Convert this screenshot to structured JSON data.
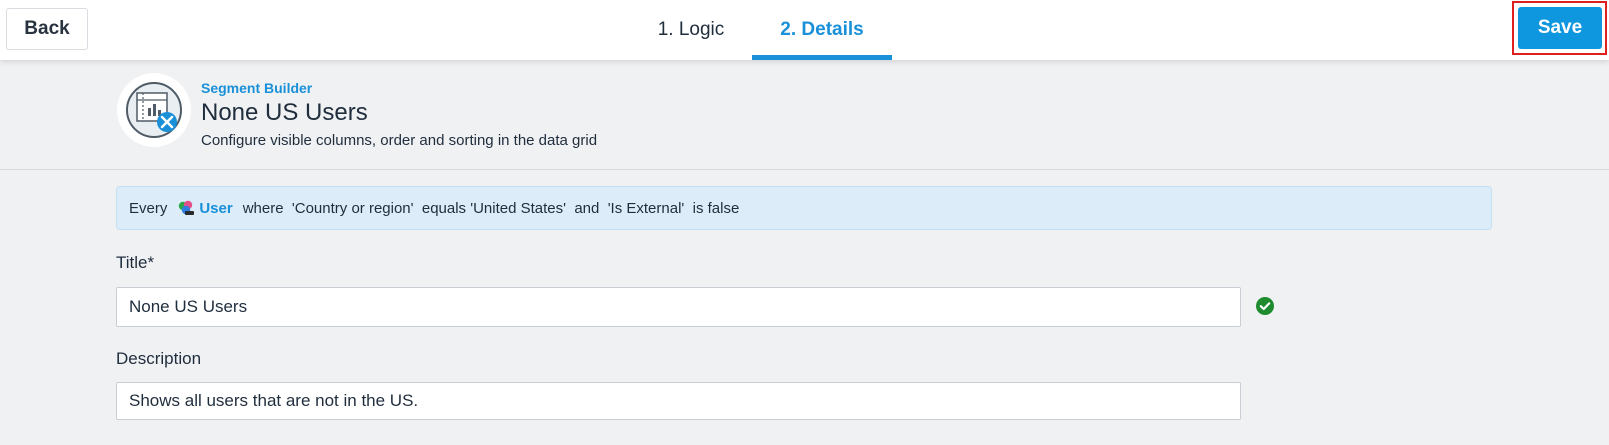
{
  "toolbar": {
    "back_label": "Back",
    "save_label": "Save",
    "tabs": [
      {
        "label": "1. Logic",
        "active": false
      },
      {
        "label": "2. Details",
        "active": true
      }
    ]
  },
  "header": {
    "breadcrumb": "Segment Builder",
    "title": "None US Users",
    "subtitle": "Configure visible columns, order and sorting in the data grid",
    "logo_icon": "segment-builder-icon"
  },
  "rule": {
    "prefix": "Every",
    "entity": "User",
    "entity_icon": "user-entity-icon",
    "condition": "where  'Country or region'  equals 'United States'  and  'Is External'  is false"
  },
  "form": {
    "title_label": "Title*",
    "title_value": "None US Users",
    "title_status_icon": "valid-check-icon",
    "description_label": "Description",
    "description_value": "Shows all users that are not in the US."
  },
  "colors": {
    "accent": "#1a90d8",
    "save": "#0e96df",
    "highlight": "#e0201f",
    "valid": "#1e8b2e",
    "banner_bg": "#dcedf9"
  }
}
